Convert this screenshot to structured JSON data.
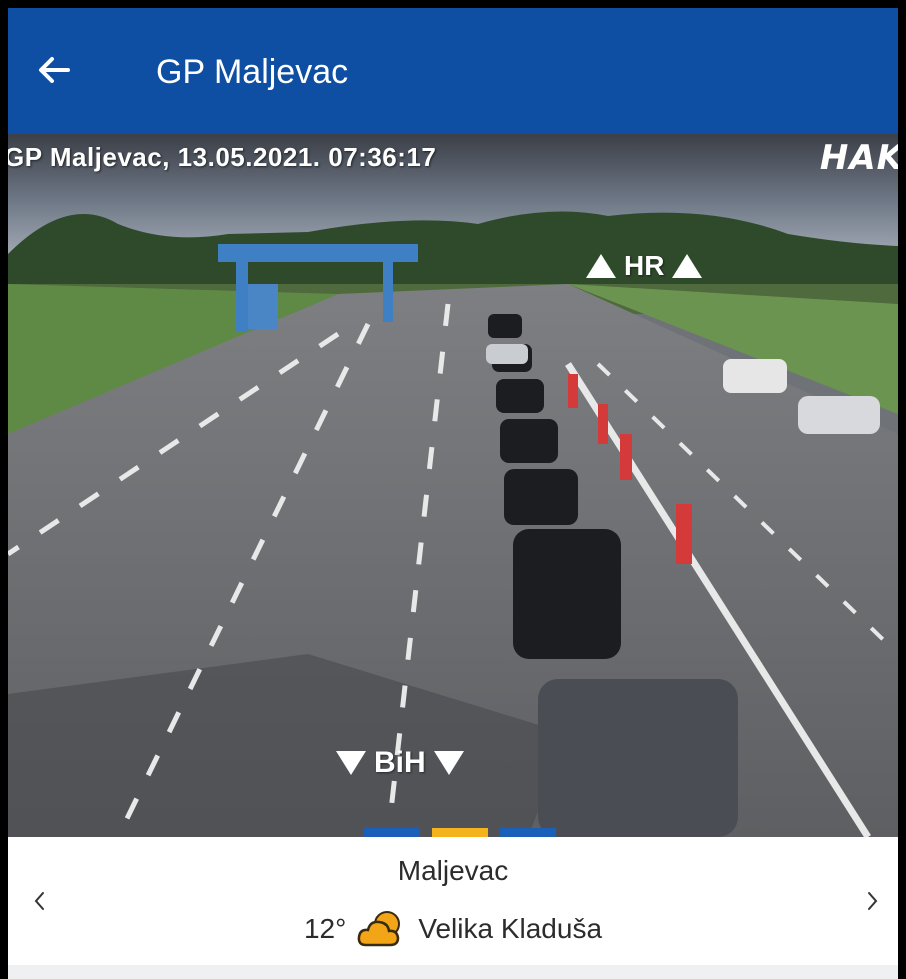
{
  "appbar": {
    "title": "GP Maljevac",
    "back_icon": "arrow-left-icon",
    "background": "#0f4fa3"
  },
  "camera": {
    "caption": "GP Maljevac, 13.05.2021. 07:36:17",
    "logo": "HAK",
    "direction_up": "HR",
    "direction_down": "BiH",
    "pager_colors": [
      "#1b5fb8",
      "#f4b21d",
      "#1b5fb8"
    ]
  },
  "location": {
    "name": "Maljevac",
    "temperature": "12°",
    "weather_icon": "partly-cloudy-icon",
    "place": "Velika Kladuša",
    "prev_icon": "chevron-left-icon",
    "next_icon": "chevron-right-icon"
  }
}
